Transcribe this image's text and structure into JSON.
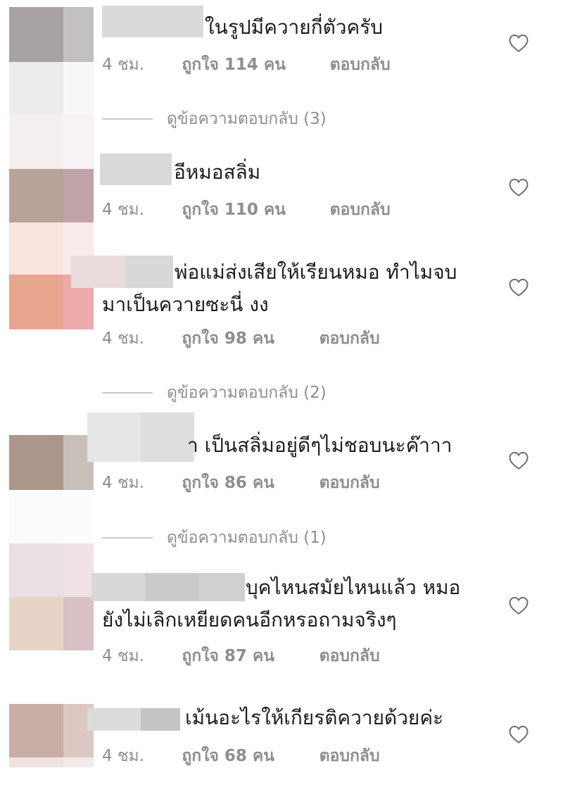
{
  "comments": [
    {
      "text": "ในรูปมีควายกี่ตัวครับ",
      "time": "4 ชม.",
      "likes": "ถูกใจ 114 คน",
      "reply": "ตอบกลับ",
      "view_replies": "ดูข้อความตอบกลับ (3)"
    },
    {
      "text": "อีหมอสลิ่ม",
      "time": "4 ชม.",
      "likes": "ถูกใจ 110 คน",
      "reply": "ตอบกลับ"
    },
    {
      "text": "พ่อแม่ส่งเสียให้เรียนหมอ ทำไมจบ\nมาเป็นควายซะนี่ งง",
      "time": "4 ชม.",
      "likes": "ถูกใจ 98 คน",
      "reply": "ตอบกลับ",
      "view_replies": "ดูข้อความตอบกลับ (2)"
    },
    {
      "text": "า เป็นสลิ่มอยู่ดีๆไม่ชอบนะค๊าาา",
      "time": "4 ชม.",
      "likes": "ถูกใจ 86 คน",
      "reply": "ตอบกลับ",
      "view_replies": "ดูข้อความตอบกลับ (1)"
    },
    {
      "text": "บุคไหนสมัยไหนแล้ว หมอ\nยังไม่เลิกเหยียดคนอีกหรอถามจริงๆ",
      "time": "4 ชม.",
      "likes": "ถูกใจ 87 คน",
      "reply": "ตอบกลับ"
    },
    {
      "text": "เม้นอะไรให้เกียรติควายด้วยค่ะ",
      "time": "4 ชม.",
      "likes": "ถูกใจ 68 คน",
      "reply": "ตอบกลับ"
    }
  ],
  "icons": {
    "like": "heart-outline-icon"
  },
  "colors": {
    "text": "#1c1c1c",
    "meta": "#8e8e8e",
    "divider": "#c8c8c8"
  }
}
